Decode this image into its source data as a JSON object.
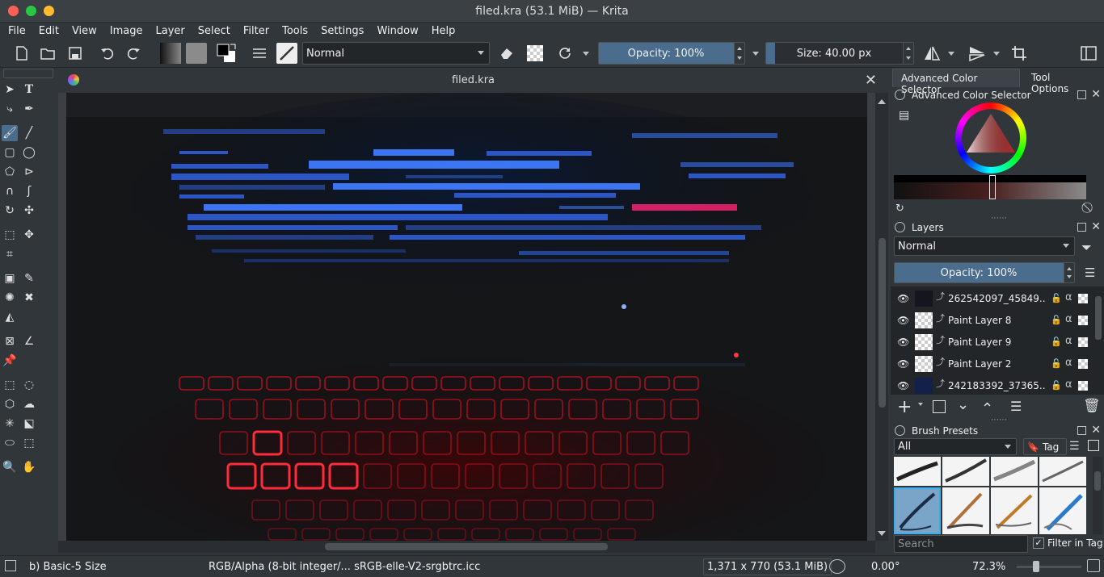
{
  "window": {
    "title": "filed.kra (53.1 MiB) — Krita"
  },
  "menu": [
    "File",
    "Edit",
    "View",
    "Image",
    "Layer",
    "Select",
    "Filter",
    "Tools",
    "Settings",
    "Window",
    "Help"
  ],
  "toolbar": {
    "blend_mode": "Normal",
    "opacity": {
      "label": "Opacity: 100%",
      "value": 1.0
    },
    "size": {
      "label": "Size: 40.00 px",
      "value": 0.06
    }
  },
  "document": {
    "tab_title": "filed.kra"
  },
  "dock": {
    "tabs": [
      "Advanced Color Selector",
      "Tool Options"
    ],
    "color_selector_title": "Advanced Color Selector",
    "layers_title": "Layers",
    "layers_blend_mode": "Normal",
    "layers_opacity": "Opacity:  100%",
    "layers": [
      {
        "name": "262542097_45849...",
        "thumb": "photo"
      },
      {
        "name": "Paint Layer 8",
        "thumb": "checker"
      },
      {
        "name": "Paint Layer 9",
        "thumb": "checker"
      },
      {
        "name": "Paint Layer 2",
        "thumb": "checker"
      },
      {
        "name": "242183392_37365...",
        "thumb": "photo-blue"
      }
    ],
    "brush_presets_title": "Brush Presets",
    "brush_filter": "All",
    "tag_label": "Tag",
    "search_placeholder": "Search",
    "filter_in_tag": "Filter in Tag"
  },
  "status": {
    "brush": "b) Basic-5 Size",
    "color_profile": "RGB/Alpha (8-bit integer/... sRGB-elle-V2-srgbtrc.icc",
    "dimensions": "1,371 x 770 (53.1 MiB)",
    "rotation": "0.00°",
    "zoom": "72.3%"
  },
  "colors": {
    "accent": "#4a6d8e",
    "highlight": "#3daee9",
    "bg": "#31363b"
  }
}
